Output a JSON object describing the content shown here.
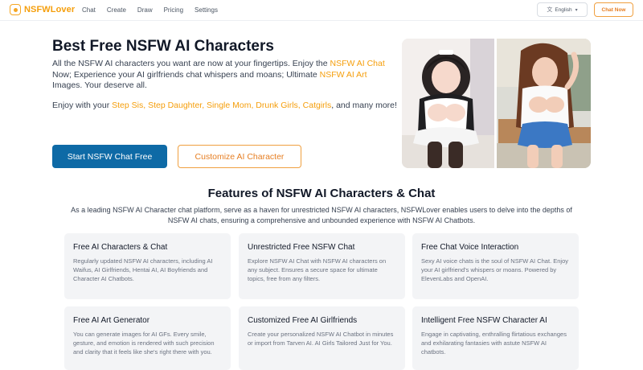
{
  "nav": {
    "logo": "NSFWLover",
    "links": [
      "Chat",
      "Create",
      "Draw",
      "Pricing",
      "Settings"
    ],
    "language": "English",
    "chat_now": "Chat Now"
  },
  "hero": {
    "title": "Best Free NSFW AI Characters",
    "desc": [
      {
        "t": "All the NSFW AI characters you want are now at your fingertips. Enjoy the ",
        "hl": false
      },
      {
        "t": "NSFW AI Chat",
        "hl": true
      },
      {
        "t": " Now; Experience your AI girlfriends chat whispers and moans; Ultimate ",
        "hl": false
      },
      {
        "t": "NSFW AI Art",
        "hl": true
      },
      {
        "t": " Images. Your deserve all.",
        "hl": false
      }
    ],
    "desc2": [
      {
        "t": "Enjoy with your ",
        "hl": false
      },
      {
        "t": "Step Sis, Step Daughter, Single Mom, Drunk Girls, Catgirls",
        "hl": true
      },
      {
        "t": ", and many more!",
        "hl": false
      }
    ],
    "primary_button": "Start NSFW Chat Free",
    "secondary_button": "Customize AI Character"
  },
  "features": {
    "title": "Features of NSFW AI Characters & Chat",
    "subtitle": "As a leading NSFW AI Character chat platform, serve as a haven for unrestricted NSFW AI characters, NSFWLover enables users to delve into the depths of NSFW AI chats, ensuring a comprehensive and unbounded experience with NSFW AI Chatbots.",
    "cards": [
      {
        "title": "Free AI Characters & Chat",
        "body": "Regularly updated NSFW AI characters, including AI Waifus, AI Girlfriends, Hentai AI, AI Boyfriends and Character AI Chatbots."
      },
      {
        "title": "Unrestricted Free NSFW Chat",
        "body": "Explore NSFW AI Chat with NSFW AI characters on any subject. Ensures a secure space for ultimate topics, free from any filters."
      },
      {
        "title": "Free Chat Voice Interaction",
        "body": "Sexy AI voice chats is the soul of NSFW AI Chat. Enjoy your AI girlfriend's whispers or moans. Powered by ElevenLabs and OpenAI."
      },
      {
        "title": "Free AI Art Generator",
        "body": "You can generate images for AI GFs. Every smile, gesture, and emotion is rendered with such precision and clarity that it feels like she's right there with you."
      },
      {
        "title": "Customized Free AI Girlfriends",
        "body": "Create your personalized NSFW AI Chatbot in minutes or import from Tarven AI. AI Girls Tailored Just for You."
      },
      {
        "title": "Intelligent Free NSFW Character AI",
        "body": "Engage in captivating, enthralling flirtatious exchanges and exhilarating fantasies with astute NSFW AI chatbots."
      }
    ]
  },
  "icons": {
    "logo": "logo-icon",
    "language": "translate-icon",
    "dropdown": "chevron-down-icon"
  },
  "colors": {
    "brand_orange": "#f59e0b",
    "primary_blue": "#0e6aa6",
    "card_bg": "#f3f4f6"
  }
}
